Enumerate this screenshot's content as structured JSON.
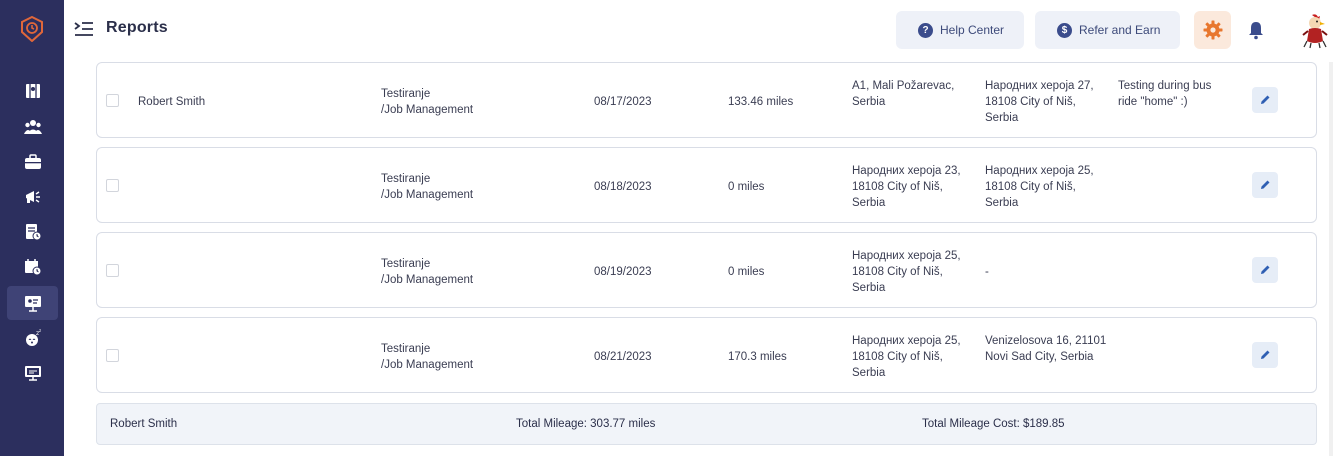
{
  "header": {
    "title": "Reports",
    "help_label": "Help Center",
    "refer_label": "Refer and Earn"
  },
  "sidebar": {
    "items": [
      {
        "icon": "map-icon"
      },
      {
        "icon": "team-icon"
      },
      {
        "icon": "briefcase-icon"
      },
      {
        "icon": "megaphone-icon"
      },
      {
        "icon": "report-clock-icon"
      },
      {
        "icon": "calendar-clock-icon"
      },
      {
        "icon": "presentation-icon",
        "active": true
      },
      {
        "icon": "sleep-icon"
      },
      {
        "icon": "monitor-icon"
      }
    ]
  },
  "rows": [
    {
      "name": "Robert Smith",
      "job_line1": "Testiranje",
      "job_line2": "/Job Management",
      "date": "08/17/2023",
      "miles": "133.46 miles",
      "from": "A1, Mali Požarevac, Serbia",
      "to": "Народних хероја 27, 18108 City of Niš, Serbia",
      "note": "Testing during bus ride \"home\" :)"
    },
    {
      "name": "",
      "job_line1": "Testiranje",
      "job_line2": "/Job Management",
      "date": "08/18/2023",
      "miles": "0 miles",
      "from": "Народних хероја 23, 18108 City of Niš, Serbia",
      "to": "Народних хероја 25, 18108 City of Niš, Serbia",
      "note": ""
    },
    {
      "name": "",
      "job_line1": "Testiranje",
      "job_line2": "/Job Management",
      "date": "08/19/2023",
      "miles": "0 miles",
      "from": "Народних хероја 25, 18108 City of Niš, Serbia",
      "to": "-",
      "note": ""
    },
    {
      "name": "",
      "job_line1": "Testiranje",
      "job_line2": "/Job Management",
      "date": "08/21/2023",
      "miles": "170.3 miles",
      "from": "Народних хероја 25, 18108 City of Niš, Serbia",
      "to": "Venizelosova 16, 21101 Novi Sad City, Serbia",
      "note": ""
    }
  ],
  "footer": {
    "name": "Robert Smith",
    "total_mileage": "Total Mileage: 303.77 miles",
    "total_cost": "Total Mileage Cost: $189.85"
  },
  "colors": {
    "sidebar": "#2c2f5e",
    "accent": "#3b4c8c",
    "gear": "#e8772e"
  }
}
